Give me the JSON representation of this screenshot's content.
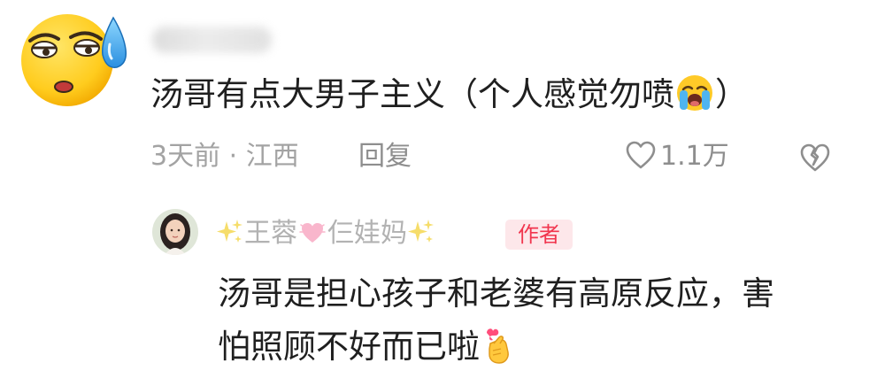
{
  "comment": {
    "avatar_icon": "sweating-face-icon",
    "username": "",
    "text_before_emoji": "汤哥有点大男子主义（个人感觉勿喷",
    "text_after_emoji": "）",
    "emoji_icon": "loudly-crying-face-icon",
    "time_location": "3天前 · 江西",
    "reply_label": "回复",
    "like_count": "1.1万"
  },
  "reply": {
    "author_name_part1": "王蓉",
    "author_name_part2": "仨娃妈",
    "author_badge": "作者",
    "text_line1": "汤哥是担心孩子和老婆有高原反应，害",
    "text_line2": "怕照顾不好而已啦",
    "end_emoji_icon": "finger-heart-hand-icon"
  },
  "colors": {
    "text_primary": "#1f1f1f",
    "meta_gray": "#a3a3a3",
    "badge_red": "#f1364f",
    "badge_bg": "#fde7ea"
  }
}
